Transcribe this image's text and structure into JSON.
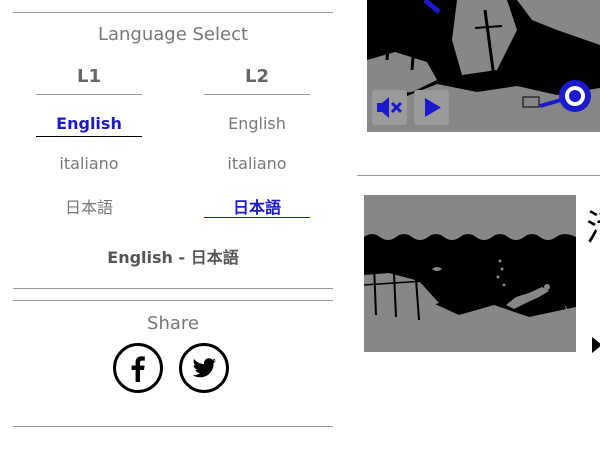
{
  "language_select": {
    "title": "Language Select",
    "l1": {
      "heading": "L1",
      "options": [
        "English",
        "italiano",
        "日本語"
      ],
      "selected": "English"
    },
    "l2": {
      "heading": "L2",
      "options": [
        "English",
        "italiano",
        "日本語"
      ],
      "selected": "日本語"
    },
    "pair": "English - 日本語"
  },
  "share": {
    "title": "Share",
    "icons": [
      "facebook-icon",
      "twitter-icon"
    ]
  },
  "video1": {
    "controls": [
      "mute-icon",
      "play-icon"
    ],
    "marker": "target-circle-icon"
  },
  "video2": {
    "scene": "underwater-diver-shipwreck"
  },
  "side": {
    "partial_char": "活",
    "arrow": "play-arrow-icon"
  },
  "colors": {
    "accent": "#1a1acc",
    "text_muted": "#777777",
    "scene_gray": "#878787",
    "scene_black": "#000000"
  }
}
